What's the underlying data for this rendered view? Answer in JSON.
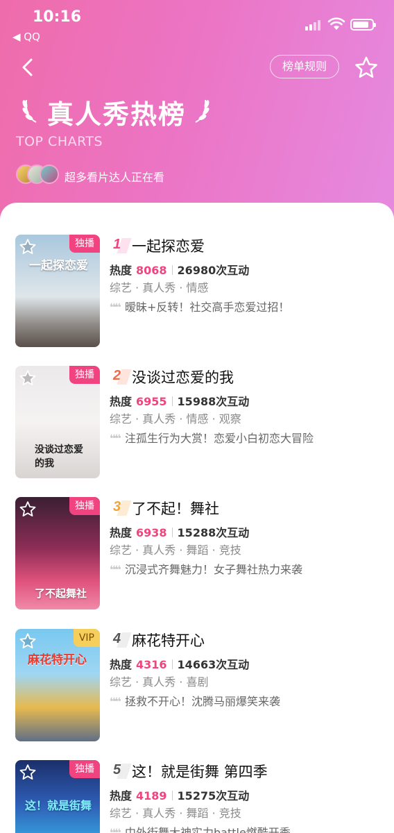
{
  "status_bar": {
    "time": "10:16",
    "back_app": "◀ QQ"
  },
  "header": {
    "rules_label": "榜单规则",
    "title": "真人秀热榜",
    "subtitle": "TOP CHARTS",
    "watching_text": "超多看片达人正在看"
  },
  "colors": {
    "accent": "#f0437f",
    "header_gradient_start": "#ef6cab",
    "header_gradient_end": "#e58ae0",
    "vip": "#f5cf5b"
  },
  "icons": {
    "back": "chevron-left-icon",
    "favorite": "star-outline-icon",
    "laurel": "laurel-icon",
    "quote": "quote-icon"
  },
  "list": {
    "hot_label": "热度",
    "items": [
      {
        "rank": "1",
        "title": "一起探恋爱",
        "badge": "独播",
        "heat": "8068",
        "interactions": "26980次互动",
        "tags": "综艺 · 真人秀 · 情感",
        "quote": "暧昧+反转！社交高手恋爱过招！",
        "poster_text": "一起探恋爱"
      },
      {
        "rank": "2",
        "title": "没谈过恋爱的我",
        "badge": "独播",
        "heat": "6955",
        "interactions": "15988次互动",
        "tags": "综艺 · 真人秀 · 情感 · 观察",
        "quote": "注孤生行为大赏！恋爱小白初恋大冒险",
        "poster_text": "没谈过恋爱的我"
      },
      {
        "rank": "3",
        "title": "了不起！舞社",
        "badge": "独播",
        "heat": "6938",
        "interactions": "15288次互动",
        "tags": "综艺 · 真人秀 · 舞蹈 · 竞技",
        "quote": "沉浸式齐舞魅力！女子舞社热力来袭",
        "poster_text": "了不起舞社"
      },
      {
        "rank": "4",
        "title": "麻花特开心",
        "badge": "VIP",
        "heat": "4316",
        "interactions": "14663次互动",
        "tags": "综艺 · 真人秀 · 喜剧",
        "quote": "拯救不开心！沈腾马丽爆笑来袭",
        "poster_text": "麻花特开心"
      },
      {
        "rank": "5",
        "title": "这！就是街舞 第四季",
        "badge": "独播",
        "heat": "4189",
        "interactions": "15275次互动",
        "tags": "综艺 · 真人秀 · 舞蹈 · 竞技",
        "quote": "中外街舞大神实力battle燃酷开季",
        "poster_text": "这！就是街舞"
      }
    ]
  }
}
